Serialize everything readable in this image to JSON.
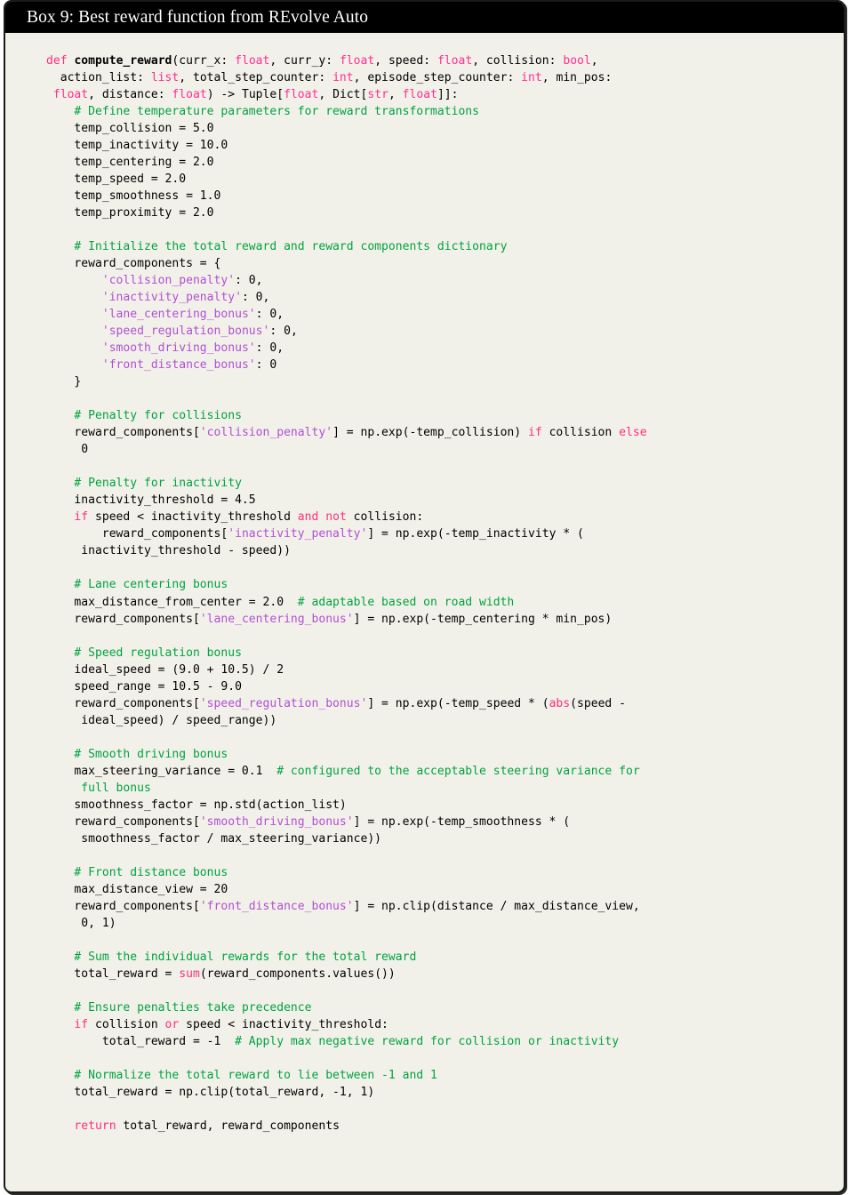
{
  "box": {
    "title": "Box 9: Best reward function from REvolve Auto",
    "header_bg": "#000000",
    "header_text_color": "#ffffff",
    "body_bg": "#f2f1e9",
    "border_color": "#1a1a18"
  },
  "syntax_colors": {
    "keyword": "#ff2e7e",
    "builtin": "#ff2e7e",
    "type_hint": "#ff2e92",
    "function_name": "#000000",
    "string": "#b24fd4",
    "comment": "#00a33f",
    "plain": "#000000"
  },
  "code": {
    "language": "python",
    "lines": [
      [
        [
          "kw",
          "def"
        ],
        [
          "pl",
          " "
        ],
        [
          "fn",
          "compute_reward"
        ],
        [
          "pl",
          "(curr_x: "
        ],
        [
          "typ",
          "float"
        ],
        [
          "pl",
          ", curr_y: "
        ],
        [
          "typ",
          "float"
        ],
        [
          "pl",
          ", speed: "
        ],
        [
          "typ",
          "float"
        ],
        [
          "pl",
          ", collision: "
        ],
        [
          "typ",
          "bool"
        ],
        [
          "pl",
          ","
        ]
      ],
      [
        [
          "pl",
          "  action_list: "
        ],
        [
          "typ",
          "list"
        ],
        [
          "pl",
          ", total_step_counter: "
        ],
        [
          "typ",
          "int"
        ],
        [
          "pl",
          ", episode_step_counter: "
        ],
        [
          "typ",
          "int"
        ],
        [
          "pl",
          ", min_pos:"
        ]
      ],
      [
        [
          "pl",
          " "
        ],
        [
          "typ",
          "float"
        ],
        [
          "pl",
          ", distance: "
        ],
        [
          "typ",
          "float"
        ],
        [
          "pl",
          ") -> Tuple["
        ],
        [
          "typ",
          "float"
        ],
        [
          "pl",
          ", Dict["
        ],
        [
          "typ",
          "str"
        ],
        [
          "pl",
          ", "
        ],
        [
          "typ",
          "float"
        ],
        [
          "pl",
          "]]:"
        ]
      ],
      [
        [
          "pl",
          "    "
        ],
        [
          "cm",
          "# Define temperature parameters for reward transformations"
        ]
      ],
      [
        [
          "pl",
          "    temp_collision = 5.0"
        ]
      ],
      [
        [
          "pl",
          "    temp_inactivity = 10.0"
        ]
      ],
      [
        [
          "pl",
          "    temp_centering = 2.0"
        ]
      ],
      [
        [
          "pl",
          "    temp_speed = 2.0"
        ]
      ],
      [
        [
          "pl",
          "    temp_smoothness = 1.0"
        ]
      ],
      [
        [
          "pl",
          "    temp_proximity = 2.0"
        ]
      ],
      [],
      [
        [
          "pl",
          "    "
        ],
        [
          "cm",
          "# Initialize the total reward and reward components dictionary"
        ]
      ],
      [
        [
          "pl",
          "    reward_components = {"
        ]
      ],
      [
        [
          "pl",
          "        "
        ],
        [
          "str",
          "'collision_penalty'"
        ],
        [
          "pl",
          ": 0,"
        ]
      ],
      [
        [
          "pl",
          "        "
        ],
        [
          "str",
          "'inactivity_penalty'"
        ],
        [
          "pl",
          ": 0,"
        ]
      ],
      [
        [
          "pl",
          "        "
        ],
        [
          "str",
          "'lane_centering_bonus'"
        ],
        [
          "pl",
          ": 0,"
        ]
      ],
      [
        [
          "pl",
          "        "
        ],
        [
          "str",
          "'speed_regulation_bonus'"
        ],
        [
          "pl",
          ": 0,"
        ]
      ],
      [
        [
          "pl",
          "        "
        ],
        [
          "str",
          "'smooth_driving_bonus'"
        ],
        [
          "pl",
          ": 0,"
        ]
      ],
      [
        [
          "pl",
          "        "
        ],
        [
          "str",
          "'front_distance_bonus'"
        ],
        [
          "pl",
          ": 0"
        ]
      ],
      [
        [
          "pl",
          "    }"
        ]
      ],
      [],
      [
        [
          "pl",
          "    "
        ],
        [
          "cm",
          "# Penalty for collisions"
        ]
      ],
      [
        [
          "pl",
          "    reward_components["
        ],
        [
          "str",
          "'collision_penalty'"
        ],
        [
          "pl",
          "] = np.exp(-temp_collision) "
        ],
        [
          "kw",
          "if"
        ],
        [
          "pl",
          " collision "
        ],
        [
          "kw",
          "else"
        ]
      ],
      [
        [
          "pl",
          "     0"
        ]
      ],
      [],
      [
        [
          "pl",
          "    "
        ],
        [
          "cm",
          "# Penalty for inactivity"
        ]
      ],
      [
        [
          "pl",
          "    inactivity_threshold = 4.5"
        ]
      ],
      [
        [
          "pl",
          "    "
        ],
        [
          "kw",
          "if"
        ],
        [
          "pl",
          " speed < inactivity_threshold "
        ],
        [
          "kw",
          "and"
        ],
        [
          "pl",
          " "
        ],
        [
          "kw",
          "not"
        ],
        [
          "pl",
          " collision:"
        ]
      ],
      [
        [
          "pl",
          "        reward_components["
        ],
        [
          "str",
          "'inactivity_penalty'"
        ],
        [
          "pl",
          "] = np.exp(-temp_inactivity * ("
        ]
      ],
      [
        [
          "pl",
          "     inactivity_threshold - speed))"
        ]
      ],
      [],
      [
        [
          "pl",
          "    "
        ],
        [
          "cm",
          "# Lane centering bonus"
        ]
      ],
      [
        [
          "pl",
          "    max_distance_from_center = 2.0  "
        ],
        [
          "cm",
          "# adaptable based on road width"
        ]
      ],
      [
        [
          "pl",
          "    reward_components["
        ],
        [
          "str",
          "'lane_centering_bonus'"
        ],
        [
          "pl",
          "] = np.exp(-temp_centering * min_pos)"
        ]
      ],
      [],
      [
        [
          "pl",
          "    "
        ],
        [
          "cm",
          "# Speed regulation bonus"
        ]
      ],
      [
        [
          "pl",
          "    ideal_speed = (9.0 + 10.5) / 2"
        ]
      ],
      [
        [
          "pl",
          "    speed_range = 10.5 - 9.0"
        ]
      ],
      [
        [
          "pl",
          "    reward_components["
        ],
        [
          "str",
          "'speed_regulation_bonus'"
        ],
        [
          "pl",
          "] = np.exp(-temp_speed * ("
        ],
        [
          "bi",
          "abs"
        ],
        [
          "pl",
          "(speed -"
        ]
      ],
      [
        [
          "pl",
          "     ideal_speed) / speed_range))"
        ]
      ],
      [],
      [
        [
          "pl",
          "    "
        ],
        [
          "cm",
          "# Smooth driving bonus"
        ]
      ],
      [
        [
          "pl",
          "    max_steering_variance = 0.1  "
        ],
        [
          "cm",
          "# configured to the acceptable steering variance for"
        ]
      ],
      [
        [
          "pl",
          "     "
        ],
        [
          "cm",
          "full bonus"
        ]
      ],
      [
        [
          "pl",
          "    smoothness_factor = np.std(action_list)"
        ]
      ],
      [
        [
          "pl",
          "    reward_components["
        ],
        [
          "str",
          "'smooth_driving_bonus'"
        ],
        [
          "pl",
          "] = np.exp(-temp_smoothness * ("
        ]
      ],
      [
        [
          "pl",
          "     smoothness_factor / max_steering_variance))"
        ]
      ],
      [],
      [
        [
          "pl",
          "    "
        ],
        [
          "cm",
          "# Front distance bonus"
        ]
      ],
      [
        [
          "pl",
          "    max_distance_view = 20"
        ]
      ],
      [
        [
          "pl",
          "    reward_components["
        ],
        [
          "str",
          "'front_distance_bonus'"
        ],
        [
          "pl",
          "] = np.clip(distance / max_distance_view,"
        ]
      ],
      [
        [
          "pl",
          "     0, 1)"
        ]
      ],
      [],
      [
        [
          "pl",
          "    "
        ],
        [
          "cm",
          "# Sum the individual rewards for the total reward"
        ]
      ],
      [
        [
          "pl",
          "    total_reward = "
        ],
        [
          "bi",
          "sum"
        ],
        [
          "pl",
          "(reward_components.values())"
        ]
      ],
      [],
      [
        [
          "pl",
          "    "
        ],
        [
          "cm",
          "# Ensure penalties take precedence"
        ]
      ],
      [
        [
          "pl",
          "    "
        ],
        [
          "kw",
          "if"
        ],
        [
          "pl",
          " collision "
        ],
        [
          "kw",
          "or"
        ],
        [
          "pl",
          " speed < inactivity_threshold:"
        ]
      ],
      [
        [
          "pl",
          "        total_reward = -1  "
        ],
        [
          "cm",
          "# Apply max negative reward for collision or inactivity"
        ]
      ],
      [],
      [
        [
          "pl",
          "    "
        ],
        [
          "cm",
          "# Normalize the total reward to lie between -1 and 1"
        ]
      ],
      [
        [
          "pl",
          "    total_reward = np.clip(total_reward, -1, 1)"
        ]
      ],
      [],
      [
        [
          "pl",
          "    "
        ],
        [
          "kw",
          "return"
        ],
        [
          "pl",
          " total_reward, reward_components"
        ]
      ]
    ]
  }
}
